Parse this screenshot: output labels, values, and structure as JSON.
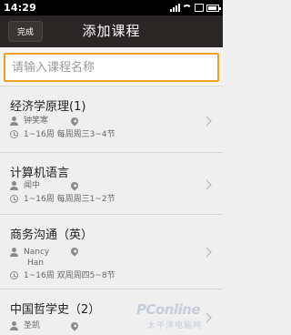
{
  "status_bar": {
    "time": "14:29"
  },
  "header": {
    "done_label": "完成",
    "title": "添加课程"
  },
  "search": {
    "placeholder": "请输入课程名称",
    "value": ""
  },
  "courses": [
    {
      "name": "经济学原理(1)",
      "teacher": "钟笑寒",
      "schedule": "1~16周 每周周三3~4节"
    },
    {
      "name": "计算机语言",
      "teacher": "闻中",
      "schedule": "1~16周 每周周三1~2节"
    },
    {
      "name": "商务沟通（英）",
      "teacher": "Nancy Han",
      "teacher_line1": "Nancy",
      "teacher_line2": "Han",
      "schedule": "1~16周 双周周四5~8节"
    },
    {
      "name": "中国哲学史（2）",
      "teacher": "圣凯",
      "schedule": ""
    }
  ],
  "watermark": {
    "logo": "PConline",
    "subtitle": "太平洋电脑网"
  },
  "icons": {
    "teacher": "person-icon",
    "location": "pin-icon",
    "time": "clock-icon",
    "open": "chevron-right-icon"
  },
  "colors": {
    "accent": "#f0a020",
    "title_bar": "#2a2625",
    "background": "#efefef"
  }
}
